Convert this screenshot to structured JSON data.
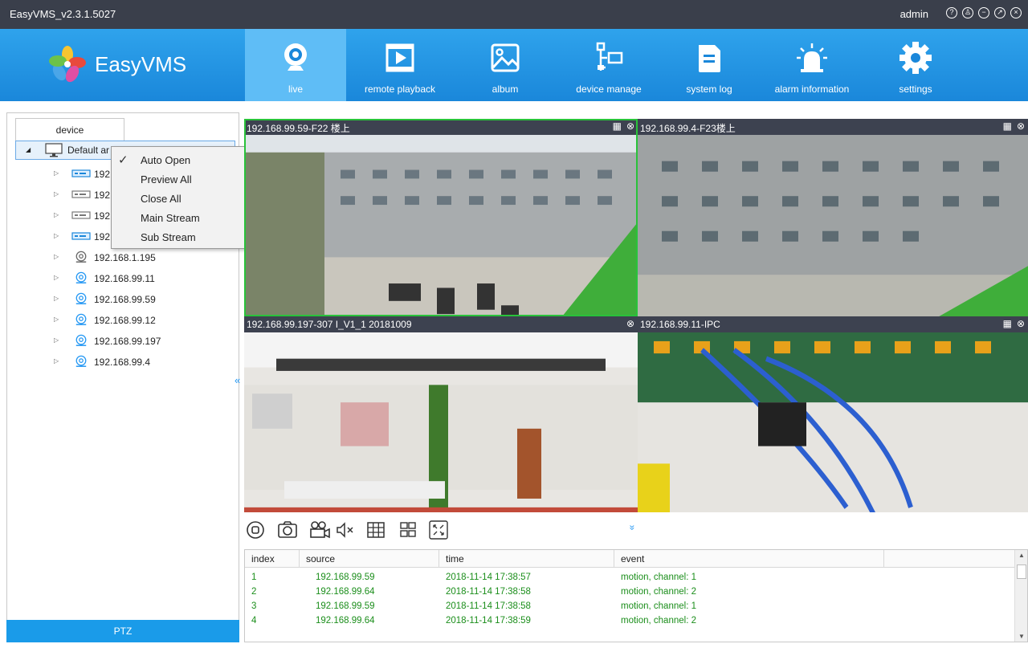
{
  "app": {
    "title": "EasyVMS_v2.3.1.5027",
    "user": "admin"
  },
  "window_buttons": [
    "help-icon",
    "user-icon",
    "minimize-icon",
    "restore-icon",
    "close-icon"
  ],
  "logo": {
    "text": "EasyVMS"
  },
  "nav": [
    {
      "label": "live",
      "icon": "camera-icon",
      "active": true
    },
    {
      "label": "remote playback",
      "icon": "playback-icon"
    },
    {
      "label": "album",
      "icon": "image-icon"
    },
    {
      "label": "device manage",
      "icon": "device-tree-icon"
    },
    {
      "label": "system log",
      "icon": "document-icon"
    },
    {
      "label": "alarm information",
      "icon": "alarm-light-icon"
    },
    {
      "label": "settings",
      "icon": "gear-icon"
    }
  ],
  "sidebar": {
    "tab": "device",
    "root": "Default ar",
    "items": [
      {
        "label": "192",
        "icon": "nvr-icon"
      },
      {
        "label": "192",
        "icon": "nvr-icon"
      },
      {
        "label": "192",
        "icon": "nvr-icon"
      },
      {
        "label": "192",
        "icon": "nvr-icon"
      },
      {
        "label": "192.168.1.195",
        "icon": "ip-camera-icon"
      },
      {
        "label": "192.168.99.11",
        "icon": "ip-camera-icon"
      },
      {
        "label": "192.168.99.59",
        "icon": "ip-camera-icon"
      },
      {
        "label": "192.168.99.12",
        "icon": "ip-camera-icon"
      },
      {
        "label": "192.168.99.197",
        "icon": "ip-camera-icon"
      },
      {
        "label": "192.168.99.4",
        "icon": "ip-camera-icon"
      }
    ],
    "ptz_label": "PTZ",
    "collapse_glyph": "«"
  },
  "context_menu": [
    {
      "label": "Auto Open",
      "checked": true
    },
    {
      "label": "Preview All"
    },
    {
      "label": "Close All"
    },
    {
      "label": "Main Stream"
    },
    {
      "label": "Sub Stream"
    }
  ],
  "videos": [
    {
      "title": "192.168.99.59-F22 楼上",
      "selected": true
    },
    {
      "title": "192.168.99.4-F23楼上"
    },
    {
      "title": "192.168.99.197-307 I_V1_1 20181009"
    },
    {
      "title": "192.168.99.11-IPC"
    }
  ],
  "toolbar": [
    "stop-icon",
    "snapshot-icon",
    "record-icon",
    "mute-icon",
    "grid-9-icon",
    "grid-4-icon",
    "fullscreen-icon"
  ],
  "expand_glyph": "»",
  "events": {
    "columns": [
      "index",
      "source",
      "time",
      "event"
    ],
    "rows": [
      [
        "1",
        "192.168.99.59",
        "2018-11-14 17:38:57",
        "motion, channel: 1"
      ],
      [
        "2",
        "192.168.99.64",
        "2018-11-14 17:38:58",
        "motion, channel: 2"
      ],
      [
        "3",
        "192.168.99.59",
        "2018-11-14 17:38:58",
        "motion, channel: 1"
      ],
      [
        "4",
        "192.168.99.64",
        "2018-11-14 17:38:59",
        "motion, channel: 2"
      ]
    ]
  },
  "colors": {
    "nav_blue": "#1a87da",
    "active_tab": "#5fbdf6",
    "event_green": "#1b8e1b",
    "selected_border": "#29c23a"
  }
}
